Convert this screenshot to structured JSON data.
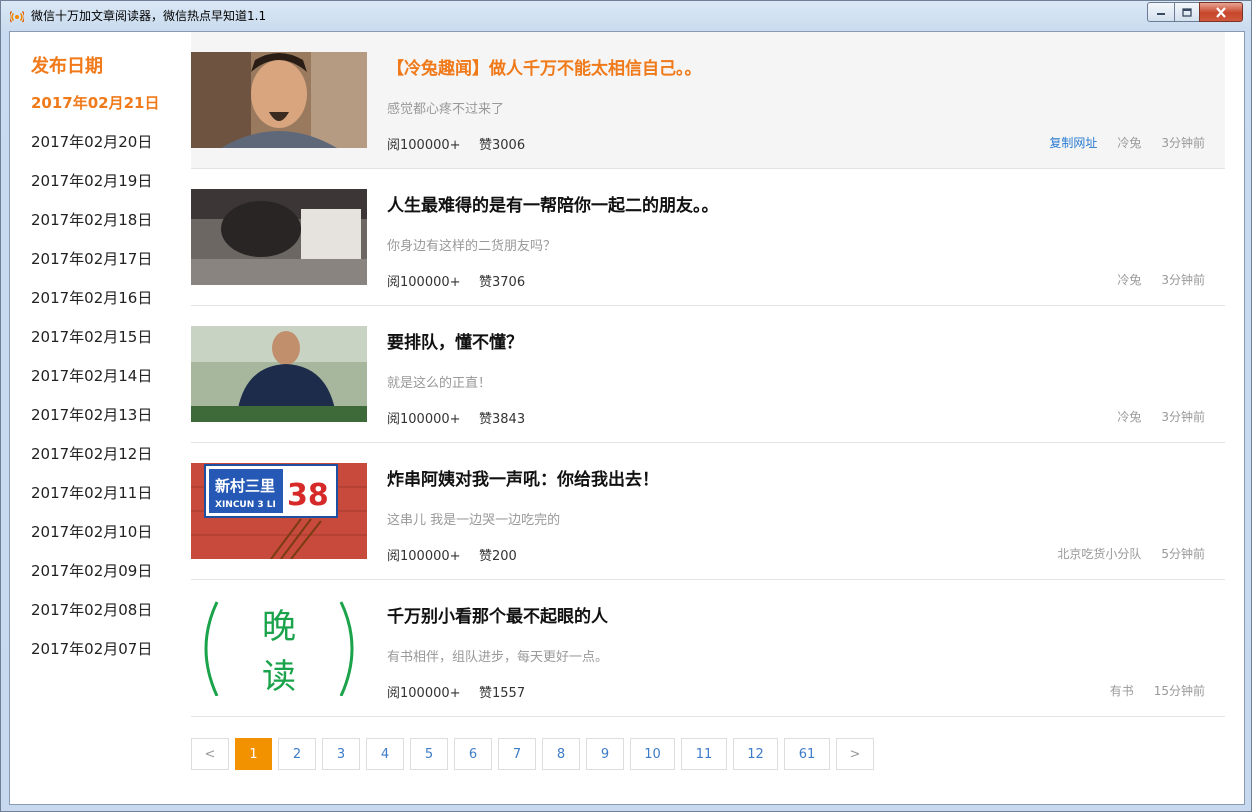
{
  "window": {
    "title": "微信十万加文章阅读器，微信热点早知道1.1"
  },
  "sidebar": {
    "heading": "发布日期",
    "dates": [
      {
        "label": "2017年02月21日",
        "active": true
      },
      {
        "label": "2017年02月20日"
      },
      {
        "label": "2017年02月19日"
      },
      {
        "label": "2017年02月18日"
      },
      {
        "label": "2017年02月17日"
      },
      {
        "label": "2017年02月16日"
      },
      {
        "label": "2017年02月15日"
      },
      {
        "label": "2017年02月14日"
      },
      {
        "label": "2017年02月13日"
      },
      {
        "label": "2017年02月12日"
      },
      {
        "label": "2017年02月11日"
      },
      {
        "label": "2017年02月10日"
      },
      {
        "label": "2017年02月09日"
      },
      {
        "label": "2017年02月08日"
      },
      {
        "label": "2017年02月07日"
      }
    ]
  },
  "articles": [
    {
      "title": "【冷兔趣闻】做人千万不能太相信自己。。",
      "summary": "感觉都心疼不过来了",
      "reads": "阅100000+",
      "likes": "赞3006",
      "copy_link": "复制网址",
      "author": "冷兔",
      "time": "3分钟前"
    },
    {
      "title": "人生最难得的是有一帮陪你一起二的朋友。。",
      "summary": "你身边有这样的二货朋友吗？",
      "reads": "阅100000+",
      "likes": "赞3706",
      "author": "冷兔",
      "time": "3分钟前"
    },
    {
      "title": "要排队，懂不懂？",
      "summary": "就是这么的正直！",
      "reads": "阅100000+",
      "likes": "赞3843",
      "author": "冷兔",
      "time": "3分钟前"
    },
    {
      "title": "炸串阿姨对我一声吼：你给我出去！",
      "summary": "这串儿 我是一边哭一边吃完的",
      "reads": "阅100000+",
      "likes": "赞200",
      "author": "北京吃货小分队",
      "time": "5分钟前"
    },
    {
      "title": "千万别小看那个最不起眼的人",
      "summary": "有书相伴，组队进步，每天更好一点。",
      "reads": "阅100000+",
      "likes": "赞1557",
      "author": "有书",
      "time": "15分钟前"
    }
  ],
  "thumb_text": {
    "sign_name": "新村三里",
    "sign_pinyin": "XINCUN 3 LI",
    "sign_number": "38",
    "calligraphy_1": "晚",
    "calligraphy_2": "读"
  },
  "pagination": {
    "prev": "<",
    "next": ">",
    "pages": [
      "1",
      "2",
      "3",
      "4",
      "5",
      "6",
      "7",
      "8",
      "9",
      "10",
      "11",
      "12",
      "61"
    ],
    "current": "1"
  },
  "colors": {
    "accent": "#f07a1a",
    "page_active": "#f39200",
    "link": "#2a7bd1"
  }
}
